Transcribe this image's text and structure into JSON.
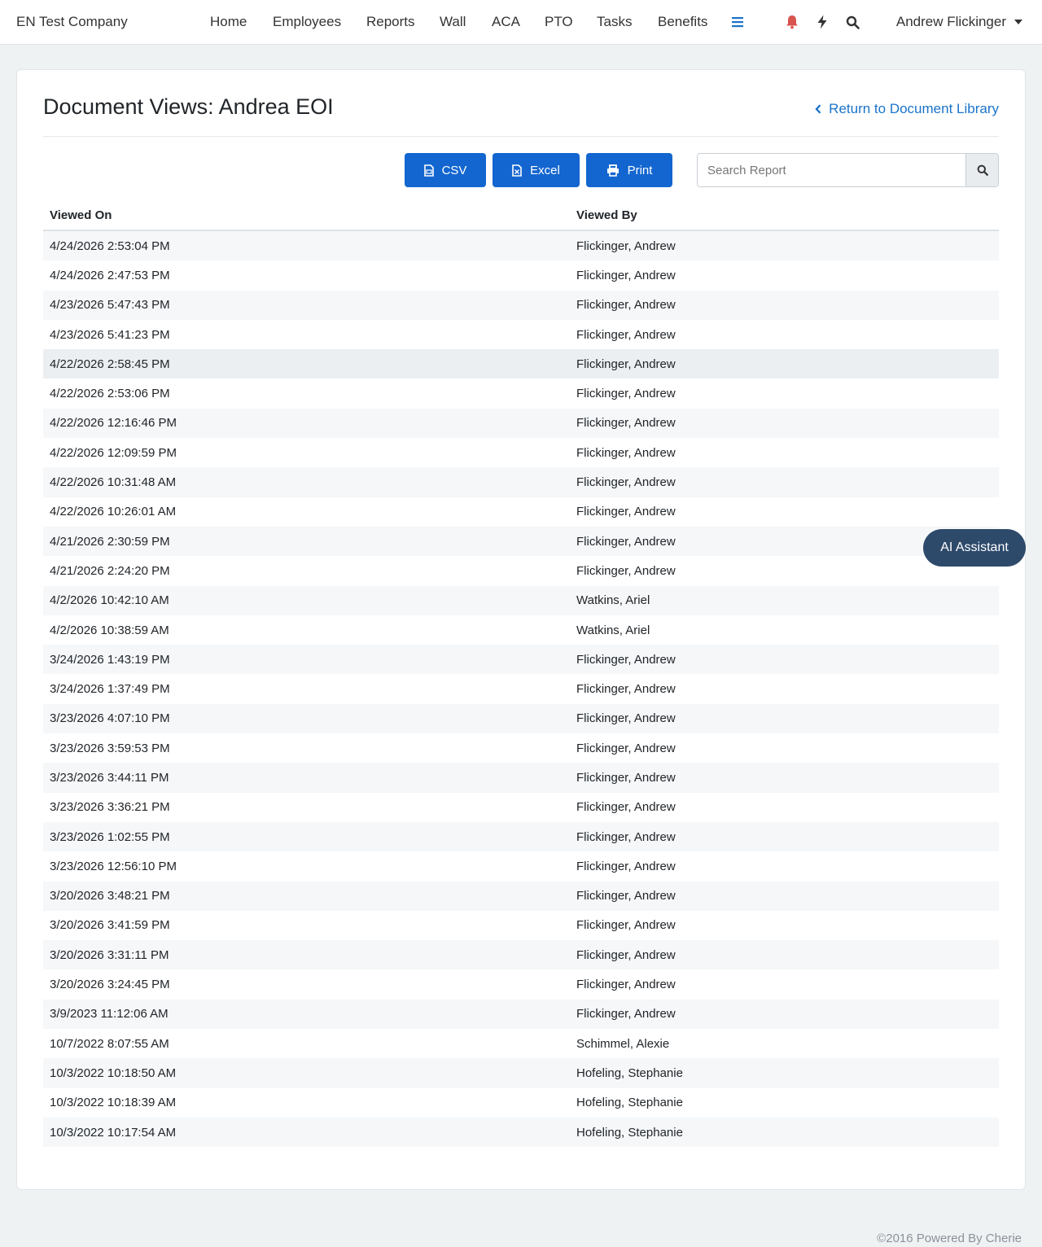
{
  "navbar": {
    "brand": "EN Test Company",
    "items": [
      "Home",
      "Employees",
      "Reports",
      "Wall",
      "ACA",
      "PTO",
      "Tasks",
      "Benefits"
    ],
    "icons": [
      "menu-icon",
      "bell-icon",
      "bolt-icon",
      "search-icon"
    ],
    "user": "Andrew Flickinger"
  },
  "page": {
    "title": "Document Views: Andrea EOI",
    "return_link": "Return to Document Library"
  },
  "toolbar": {
    "csv_label": "CSV",
    "excel_label": "Excel",
    "print_label": "Print",
    "search_placeholder": "Search Report"
  },
  "table": {
    "headers": [
      "Viewed On",
      "Viewed By"
    ],
    "rows": [
      [
        "4/24/2026 2:53:04 PM",
        "Flickinger, Andrew"
      ],
      [
        "4/24/2026 2:47:53 PM",
        "Flickinger, Andrew"
      ],
      [
        "4/23/2026 5:47:43 PM",
        "Flickinger, Andrew"
      ],
      [
        "4/23/2026 5:41:23 PM",
        "Flickinger, Andrew"
      ],
      [
        "4/22/2026 2:58:45 PM",
        "Flickinger, Andrew"
      ],
      [
        "4/22/2026 2:53:06 PM",
        "Flickinger, Andrew"
      ],
      [
        "4/22/2026 12:16:46 PM",
        "Flickinger, Andrew"
      ],
      [
        "4/22/2026 12:09:59 PM",
        "Flickinger, Andrew"
      ],
      [
        "4/22/2026 10:31:48 AM",
        "Flickinger, Andrew"
      ],
      [
        "4/22/2026 10:26:01 AM",
        "Flickinger, Andrew"
      ],
      [
        "4/21/2026 2:30:59 PM",
        "Flickinger, Andrew"
      ],
      [
        "4/21/2026 2:24:20 PM",
        "Flickinger, Andrew"
      ],
      [
        "4/2/2026 10:42:10 AM",
        "Watkins, Ariel"
      ],
      [
        "4/2/2026 10:38:59 AM",
        "Watkins, Ariel"
      ],
      [
        "3/24/2026 1:43:19 PM",
        "Flickinger, Andrew"
      ],
      [
        "3/24/2026 1:37:49 PM",
        "Flickinger, Andrew"
      ],
      [
        "3/23/2026 4:07:10 PM",
        "Flickinger, Andrew"
      ],
      [
        "3/23/2026 3:59:53 PM",
        "Flickinger, Andrew"
      ],
      [
        "3/23/2026 3:44:11 PM",
        "Flickinger, Andrew"
      ],
      [
        "3/23/2026 3:36:21 PM",
        "Flickinger, Andrew"
      ],
      [
        "3/23/2026 1:02:55 PM",
        "Flickinger, Andrew"
      ],
      [
        "3/23/2026 12:56:10 PM",
        "Flickinger, Andrew"
      ],
      [
        "3/20/2026 3:48:21 PM",
        "Flickinger, Andrew"
      ],
      [
        "3/20/2026 3:41:59 PM",
        "Flickinger, Andrew"
      ],
      [
        "3/20/2026 3:31:11 PM",
        "Flickinger, Andrew"
      ],
      [
        "3/20/2026 3:24:45 PM",
        "Flickinger, Andrew"
      ],
      [
        "3/9/2023 11:12:06 AM",
        "Flickinger, Andrew"
      ],
      [
        "10/7/2022 8:07:55 AM",
        "Schimmel, Alexie"
      ],
      [
        "10/3/2022 10:18:50 AM",
        "Hofeling, Stephanie"
      ],
      [
        "10/3/2022 10:18:39 AM",
        "Hofeling, Stephanie"
      ],
      [
        "10/3/2022 10:17:54 AM",
        "Hofeling, Stephanie"
      ]
    ]
  },
  "ai_assistant": {
    "label": "AI Assistant"
  },
  "footer": {
    "text": "©2016 Powered By Cherie"
  },
  "colors": {
    "primary": "#1366d0",
    "link": "#1a73c9",
    "bell": "#d9534f",
    "ai_button": "#2e4a6b"
  }
}
